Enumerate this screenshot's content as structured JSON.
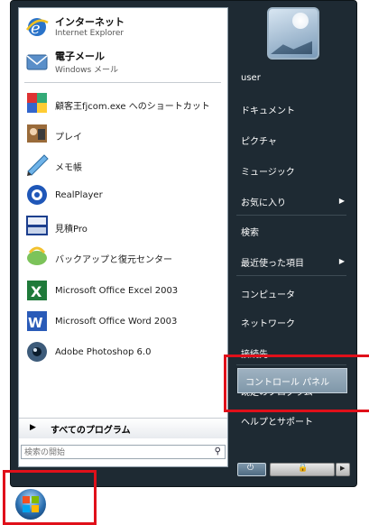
{
  "pinned": [
    {
      "title": "インターネット",
      "subtitle": "Internet Explorer",
      "icon": "internet-explorer-icon"
    },
    {
      "title": "電子メール",
      "subtitle": "Windows メール",
      "icon": "mail-icon"
    }
  ],
  "recent": [
    {
      "label": "顧客王fjcom.exe へのショートカット",
      "icon": "shortcut-app-icon"
    },
    {
      "label": "プレイ",
      "icon": "play-app-icon"
    },
    {
      "label": "メモ帳",
      "icon": "notepad-icon"
    },
    {
      "label": "RealPlayer",
      "icon": "realplayer-icon"
    },
    {
      "label": "見積Pro",
      "icon": "mitsumori-pro-icon"
    },
    {
      "label": "バックアップと復元センター",
      "icon": "backup-icon"
    },
    {
      "label": "Microsoft Office Excel 2003",
      "icon": "excel-icon"
    },
    {
      "label": "Microsoft Office Word 2003",
      "icon": "word-icon"
    },
    {
      "label": "Adobe Photoshop 6.0",
      "icon": "photoshop-icon"
    }
  ],
  "all_programs": "すべてのプログラム",
  "search_placeholder": "検索の開始",
  "right": {
    "user": "user",
    "documents": "ドキュメント",
    "pictures": "ピクチャ",
    "music": "ミュージック",
    "favorites": "お気に入り",
    "search": "検索",
    "recent_items": "最近使った項目",
    "computer": "コンピュータ",
    "network": "ネットワーク",
    "connect_to": "接続先",
    "control_panel": "コントロール パネル",
    "default_programs": "既定のプログラム",
    "help": "ヘルプとサポート"
  },
  "colors": {
    "highlight_border": "#e0101a",
    "menu_dark": "#1e2a33"
  }
}
